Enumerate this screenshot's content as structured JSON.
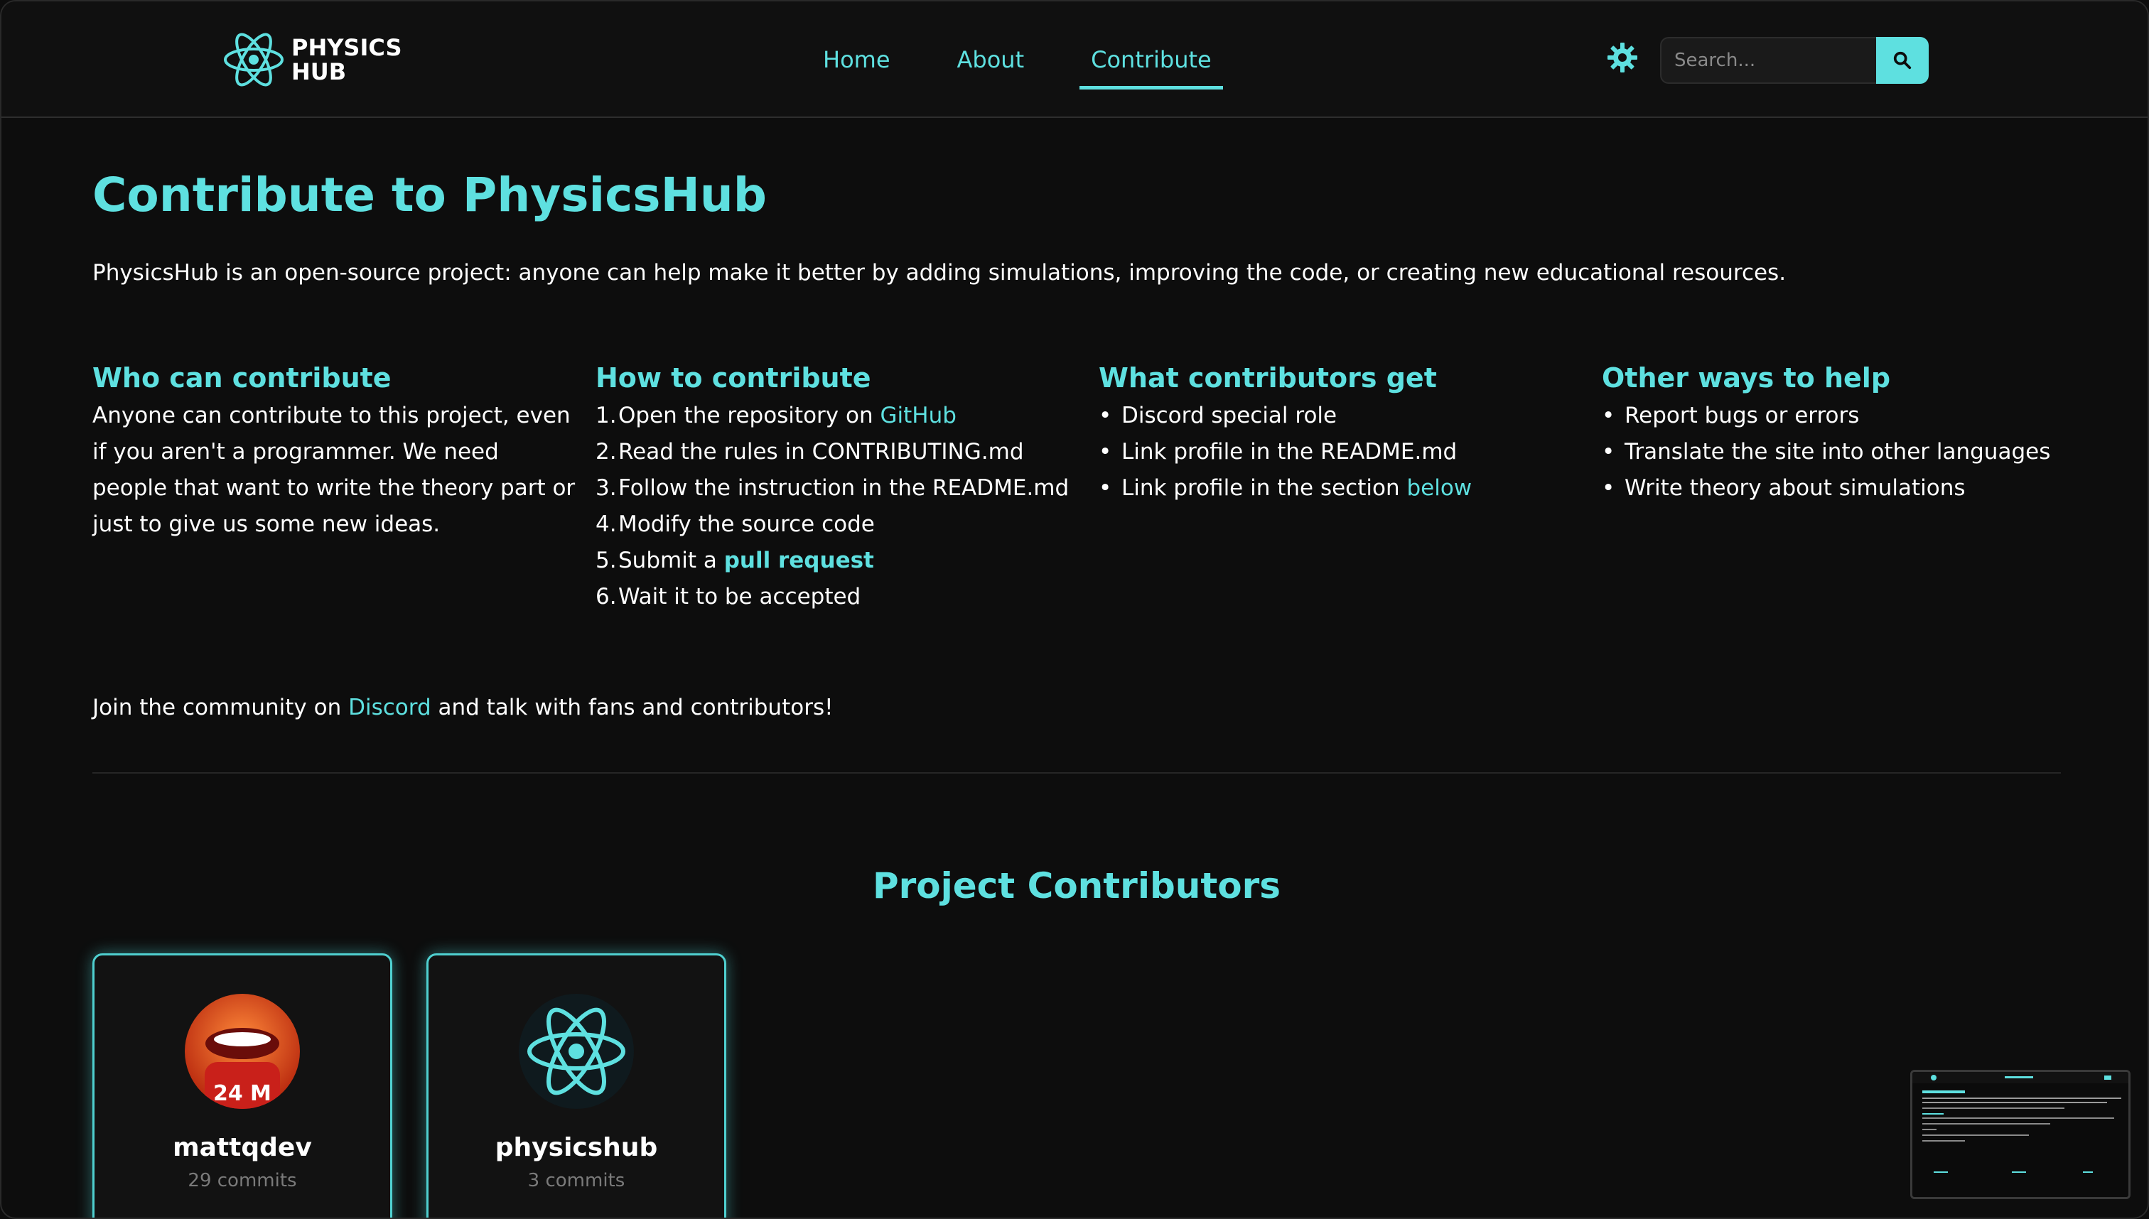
{
  "brand": {
    "line1": "PHYSICS",
    "line2": "HUB"
  },
  "nav": [
    {
      "label": "Home",
      "active": false
    },
    {
      "label": "About",
      "active": false
    },
    {
      "label": "Contribute",
      "active": true
    }
  ],
  "header": {
    "theme_icon": "gear-icon",
    "search_placeholder": "Search...",
    "search_icon": "search-icon"
  },
  "page": {
    "title": "Contribute to PhysicsHub",
    "intro": "PhysicsHub is an open-source project: anyone can help make it better by adding simulations, improving the code, or creating new educational resources."
  },
  "sections": {
    "who": {
      "title": "Who can contribute",
      "text": "Anyone can contribute to this project, even if you aren't a programmer. We need people that want to write the theory part or just to give us some new ideas."
    },
    "how": {
      "title": "How to contribute",
      "steps": [
        {
          "num": "1.",
          "text": "Open the repository on ",
          "link": "GitHub"
        },
        {
          "num": "2.",
          "text": "Read the rules in CONTRIBUTING.md"
        },
        {
          "num": "3.",
          "text": "Follow the instruction in the README.md"
        },
        {
          "num": "4.",
          "text": "Modify the source code"
        },
        {
          "num": "5.",
          "text": "Submit a ",
          "link": "pull request"
        },
        {
          "num": "6.",
          "text": "Wait it to be accepted"
        }
      ]
    },
    "get": {
      "title": "What contributors get",
      "items": [
        {
          "text": "Discord special role"
        },
        {
          "text": "Link profile in the README.md"
        },
        {
          "text": "Link profile in the section ",
          "link": "below"
        }
      ]
    },
    "other": {
      "title": "Other ways to help",
      "items": [
        {
          "text": "Report bugs or errors"
        },
        {
          "text": "Translate the site into other languages"
        },
        {
          "text": "Write theory about simulations"
        }
      ]
    }
  },
  "community": {
    "before": "Join the community on ",
    "link": "Discord",
    "after": " and talk with fans and contributors!"
  },
  "contributors": {
    "title": "Project Contributors",
    "list": [
      {
        "name": "mattqdev",
        "commits": "29 commits",
        "avatar": "user-photo-avatar"
      },
      {
        "name": "physicshub",
        "commits": "3 commits",
        "avatar": "atom-logo-avatar"
      }
    ]
  },
  "colors": {
    "accent": "#5ee0e0",
    "background": "#0d0d0d",
    "text": "#ffffff",
    "muted": "#7a7a7a"
  }
}
